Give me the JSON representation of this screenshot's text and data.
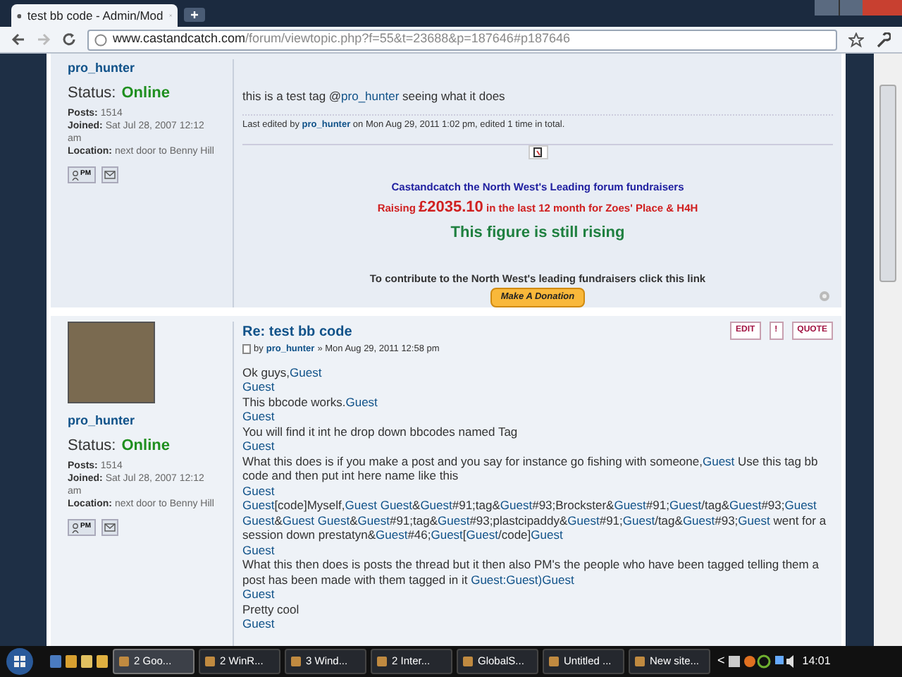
{
  "browser": {
    "tab_title": "test bb code - Admin/Mod",
    "url_host": "www.castandcatch.com",
    "url_path": "/forum/viewtopic.php?f=55&t=23688&p=187646#p187646"
  },
  "posts": [
    {
      "author": "pro_hunter",
      "status_label": "Status:",
      "status": "Online",
      "posts_label": "Posts:",
      "posts": "1514",
      "joined_label": "Joined:",
      "joined": "Sat Jul 28, 2007 12:12 am",
      "location_label": "Location:",
      "location": "next door to Benny Hill",
      "pm": "PM",
      "body": [
        [
          {
            "kind": "text",
            "text": "this is a test tag @"
          },
          {
            "kind": "link",
            "text": "pro_hunter"
          },
          {
            "kind": "text",
            "text": " seeing what it does"
          }
        ]
      ],
      "edit_note": {
        "prefix": "Last edited by",
        "user": "pro_hunter",
        "suffix": "on Mon Aug 29, 2011 1:02 pm, edited 1 time in total."
      },
      "signature": {
        "line1": "Castandcatch the North West's Leading forum fundraisers",
        "raising_pre": "Raising",
        "amount": "£2035.10",
        "raising_post": "in the last 12 month for Zoes' Place & H4H",
        "rising": "This figure is still rising",
        "contribute": "To contribute to the North West's leading fundraisers click this link",
        "donate": "Make A Donation"
      }
    },
    {
      "author": "pro_hunter",
      "status_label": "Status:",
      "status": "Online",
      "posts_label": "Posts:",
      "posts": "1514",
      "joined_label": "Joined:",
      "joined": "Sat Jul 28, 2007 12:12 am",
      "location_label": "Location:",
      "location": "next door to Benny Hill",
      "pm": "PM",
      "title": "Re: test bb code",
      "by": "by",
      "by_user": "pro_hunter",
      "date": "» Mon Aug 29, 2011 12:58 pm",
      "buttons": [
        "EDIT",
        "!",
        "QUOTE"
      ],
      "body": [
        [
          {
            "kind": "text",
            "text": "Ok guys,"
          },
          {
            "kind": "link",
            "text": "Guest"
          }
        ],
        [
          {
            "kind": "link",
            "text": "Guest"
          }
        ],
        [
          {
            "kind": "text",
            "text": "This bbcode works."
          },
          {
            "kind": "link",
            "text": "Guest"
          }
        ],
        [
          {
            "kind": "link",
            "text": "Guest"
          }
        ],
        [
          {
            "kind": "text",
            "text": "You will find it int he drop down bbcodes named Tag"
          }
        ],
        [
          {
            "kind": "link",
            "text": "Guest"
          }
        ],
        [
          {
            "kind": "text",
            "text": "What this does is if you make a post and you say for instance go fishing with someone,"
          },
          {
            "kind": "link",
            "text": "Guest"
          },
          {
            "kind": "text",
            "text": " Use this tag bb code and then put int here name like this"
          }
        ],
        [
          {
            "kind": "link",
            "text": "Guest"
          }
        ],
        [
          {
            "kind": "link",
            "text": "Guest"
          },
          {
            "kind": "text",
            "text": "[code]Myself,"
          },
          {
            "kind": "link",
            "text": "Guest"
          },
          {
            "kind": "link",
            "text": "Guest",
            "space_before": true
          },
          {
            "kind": "text",
            "text": "&"
          },
          {
            "kind": "link",
            "text": "Guest"
          },
          {
            "kind": "text",
            "text": "#91;tag&"
          },
          {
            "kind": "link",
            "text": "Guest"
          },
          {
            "kind": "text",
            "text": "#93;Brockster&"
          },
          {
            "kind": "link",
            "text": "Guest"
          },
          {
            "kind": "text",
            "text": "#91;"
          },
          {
            "kind": "link",
            "text": "Guest"
          },
          {
            "kind": "text",
            "text": "/tag&"
          },
          {
            "kind": "link",
            "text": "Guest"
          },
          {
            "kind": "text",
            "text": "#93;"
          },
          {
            "kind": "link",
            "text": "Guest"
          },
          {
            "kind": "link",
            "text": "Guest",
            "space_before": true
          },
          {
            "kind": "text",
            "text": "&"
          },
          {
            "kind": "link",
            "text": "Guest"
          },
          {
            "kind": "link",
            "text": "Guest",
            "space_before": true
          },
          {
            "kind": "text",
            "text": "&"
          },
          {
            "kind": "link",
            "text": "Guest"
          },
          {
            "kind": "text",
            "text": "#91;tag&"
          },
          {
            "kind": "link",
            "text": "Guest"
          },
          {
            "kind": "text",
            "text": "#93;plastcipaddy&"
          },
          {
            "kind": "link",
            "text": "Guest"
          },
          {
            "kind": "text",
            "text": "#91;"
          },
          {
            "kind": "link",
            "text": "Guest"
          },
          {
            "kind": "text",
            "text": "/tag&"
          },
          {
            "kind": "link",
            "text": "Guest"
          },
          {
            "kind": "text",
            "text": "#93;"
          },
          {
            "kind": "link",
            "text": "Guest"
          },
          {
            "kind": "text",
            "text": " went for a session down prestatyn&"
          },
          {
            "kind": "link",
            "text": "Guest"
          },
          {
            "kind": "text",
            "text": "#46;"
          },
          {
            "kind": "link",
            "text": "Guest"
          },
          {
            "kind": "text",
            "text": "["
          },
          {
            "kind": "link",
            "text": "Guest"
          },
          {
            "kind": "text",
            "text": "/code]"
          },
          {
            "kind": "link",
            "text": "Guest"
          }
        ],
        [
          {
            "kind": "link",
            "text": "Guest"
          }
        ],
        [
          {
            "kind": "text",
            "text": "What this then does is posts the thread but it then also PM's the people who have been tagged telling them a post has been made with them tagged in it "
          },
          {
            "kind": "link",
            "text": "Guest:Guest)Guest"
          }
        ],
        [
          {
            "kind": "link",
            "text": "Guest"
          }
        ],
        [
          {
            "kind": "text",
            "text": "Pretty cool"
          }
        ],
        [
          {
            "kind": "link",
            "text": "Guest"
          }
        ]
      ]
    }
  ],
  "taskbar": {
    "items": [
      {
        "label": "2 Goo...",
        "selected": true
      },
      {
        "label": "2 WinR...",
        "selected": false
      },
      {
        "label": "3 Wind...",
        "selected": false
      },
      {
        "label": "2 Inter...",
        "selected": false
      },
      {
        "label": "GlobalS...",
        "selected": false
      },
      {
        "label": "Untitled ...",
        "selected": false
      },
      {
        "label": "New site...",
        "selected": false
      }
    ],
    "tray_arrow": "<",
    "clock": "14:01"
  }
}
